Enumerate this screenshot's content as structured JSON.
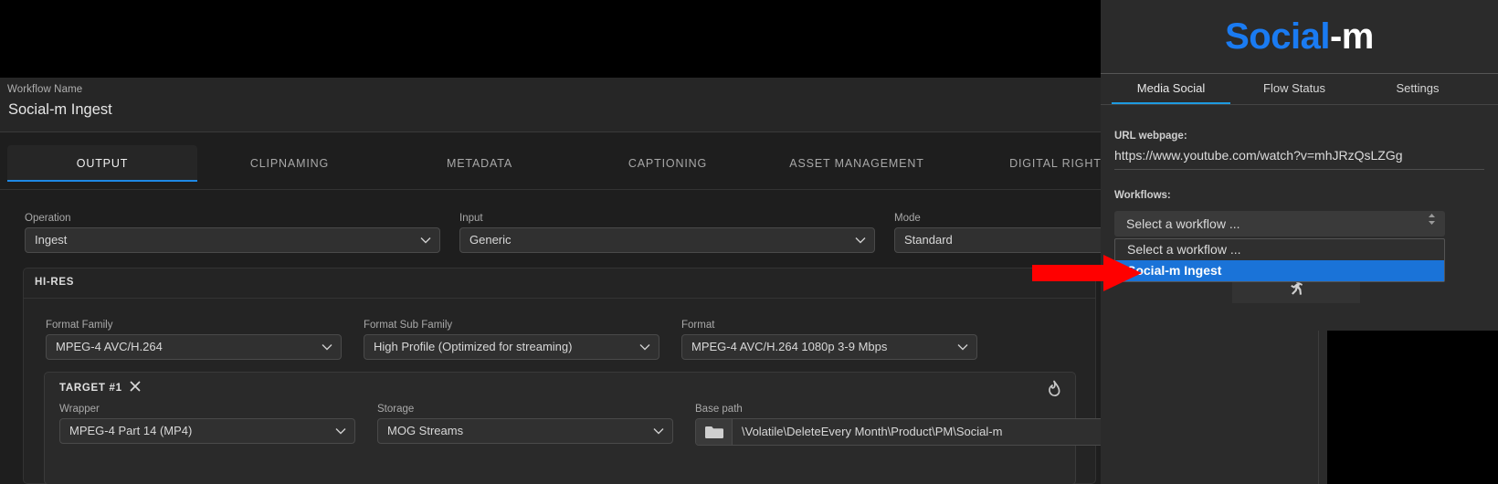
{
  "app": {
    "workflow_name": {
      "label": "Workflow Name",
      "value": "Social-m Ingest"
    },
    "tabs": [
      {
        "label": "OUTPUT",
        "active": true
      },
      {
        "label": "CLIPNAMING",
        "active": false
      },
      {
        "label": "METADATA",
        "active": false
      },
      {
        "label": "CAPTIONING",
        "active": false
      },
      {
        "label": "ASSET MANAGEMENT",
        "active": false
      },
      {
        "label": "DIGITAL RIGHTS",
        "active": false
      }
    ],
    "main_fields": [
      {
        "label": "Operation",
        "value": "Ingest"
      },
      {
        "label": "Input",
        "value": "Generic"
      },
      {
        "label": "Mode",
        "value": "Standard"
      }
    ],
    "hires": {
      "title": "HI-RES",
      "fields": [
        {
          "label": "Format Family",
          "value": "MPEG-4 AVC/H.264"
        },
        {
          "label": "Format Sub Family",
          "value": "High Profile (Optimized for streaming)"
        },
        {
          "label": "Format",
          "value": "MPEG-4 AVC/H.264 1080p 3-9 Mbps"
        }
      ],
      "target": {
        "title": "TARGET #1",
        "close_icon": "close-x-icon",
        "flame_icon": "flame-icon",
        "fields": [
          {
            "label": "Wrapper",
            "value": "MPEG-4 Part 14 (MP4)"
          },
          {
            "label": "Storage",
            "value": "MOG Streams"
          }
        ],
        "base_path": {
          "label": "Base path",
          "value": "\\Volatile\\DeleteEvery Month\\Product\\PM\\Social-m",
          "folder_icon": "folder-icon"
        }
      }
    }
  },
  "side_panel": {
    "brand": {
      "part1": "Social",
      "part2": "-m"
    },
    "tabs": [
      {
        "label": "Media Social",
        "active": true
      },
      {
        "label": "Flow Status",
        "active": false
      },
      {
        "label": "Settings",
        "active": false
      }
    ],
    "url": {
      "label": "URL webpage:",
      "value": "https://www.youtube.com/watch?v=mhJRzQsLZGg"
    },
    "workflows": {
      "label": "Workflows:",
      "selected": "Select a workflow ...",
      "options": [
        {
          "label": "Select a workflow ...",
          "highlighted": false
        },
        {
          "label": "Social-m Ingest",
          "highlighted": true
        }
      ]
    },
    "run_icon": "running-person-icon"
  },
  "annotation": {
    "arrow_icon": "red-arrow-pointer",
    "color": "#ff0000"
  },
  "colors": {
    "accent_blue": "#1a7bf2",
    "tab_underline": "#1e9be0",
    "highlight": "#1a73d8",
    "panel_bg": "#2b2b2b",
    "app_bg": "#1e1e1e"
  }
}
